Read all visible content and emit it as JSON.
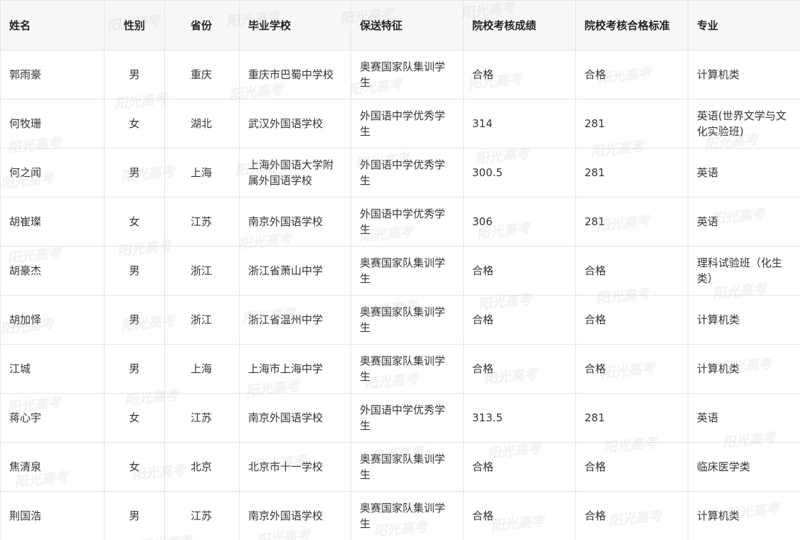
{
  "watermark_text": "阳光高考",
  "columns": [
    "姓名",
    "性别",
    "省份",
    "毕业学校",
    "保送特征",
    "院校考核成绩",
    "院校考核合格标准",
    "专业"
  ],
  "rows": [
    [
      "郭雨豪",
      "男",
      "重庆",
      "重庆市巴蜀中学校",
      "奥赛国家队集训学生",
      "合格",
      "合格",
      "计算机类"
    ],
    [
      "何牧珊",
      "女",
      "湖北",
      "武汉外国语学校",
      "外国语中学优秀学生",
      "314",
      "281",
      "英语(世界文学与文化实验班)"
    ],
    [
      "何之闻",
      "男",
      "上海",
      "上海外国语大学附属外国语学校",
      "外国语中学优秀学生",
      "300.5",
      "281",
      "英语"
    ],
    [
      "胡崔璨",
      "女",
      "江苏",
      "南京外国语学校",
      "外国语中学优秀学生",
      "306",
      "281",
      "英语"
    ],
    [
      "胡豪杰",
      "男",
      "浙江",
      "浙江省萧山中学",
      "奥赛国家队集训学生",
      "合格",
      "合格",
      "理科试验班（化生类）"
    ],
    [
      "胡加怿",
      "男",
      "浙江",
      "浙江省温州中学",
      "奥赛国家队集训学生",
      "合格",
      "合格",
      "计算机类"
    ],
    [
      "江城",
      "男",
      "上海",
      "上海市上海中学",
      "奥赛国家队集训学生",
      "合格",
      "合格",
      "计算机类"
    ],
    [
      "蒋心宇",
      "女",
      "江苏",
      "南京外国语学校",
      "外国语中学优秀学生",
      "313.5",
      "281",
      "英语"
    ],
    [
      "焦清泉",
      "女",
      "北京",
      "北京市十一学校",
      "奥赛国家队集训学生",
      "合格",
      "合格",
      "临床医学类"
    ],
    [
      "荆国浩",
      "男",
      "江苏",
      "南京外国语学校",
      "奥赛国家队集训学生",
      "合格",
      "合格",
      "计算机类"
    ]
  ]
}
